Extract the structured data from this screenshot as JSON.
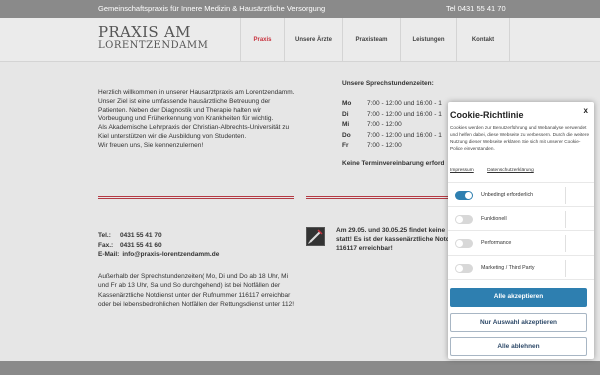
{
  "topbar": {
    "tagline": "Gemeinschaftspraxis für Innere Medizin & Hausärztliche Versorgung",
    "phone": "Tel 0431 55 41 70"
  },
  "logo": {
    "line1": "PRAXIS AM",
    "line2": "LORENTZENDAMM"
  },
  "nav": [
    {
      "label": "Praxis",
      "active": true
    },
    {
      "label": "Unsere Ärzte",
      "active": false
    },
    {
      "label": "Praxisteam",
      "active": false
    },
    {
      "label": "Leistungen",
      "active": false
    },
    {
      "label": "Kontakt",
      "active": false
    }
  ],
  "intro": {
    "p1": "Herzlich willkommen in unserer Hausarztpraxis am Lorentzendamm. Unser Ziel ist eine umfassende hausärztliche Betreuung der Patienten. Neben der Diagnostik und Therapie halten wir Vorbeugung und Früherkennung von Krankheiten für wichtig.",
    "p2": "Als Akademische Lehrpraxis der Christian-Albrechts-Universität zu Kiel unterstützen wir die Ausbildung von Studenten.",
    "p3": "Wir freuen uns, Sie kennenzulernen!"
  },
  "hours": {
    "title": "Unsere Sprechstundenzeiten:",
    "rows": [
      {
        "day": "Mo",
        "time": "7:00 - 12:00 und 16:00 - 1"
      },
      {
        "day": "Di",
        "time": "7:00 - 12:00 und 16:00 - 1"
      },
      {
        "day": "Mi",
        "time": "7:00 - 12:00"
      },
      {
        "day": "Do",
        "time": "7:00 - 12:00 und 16:00 - 1"
      },
      {
        "day": "Fr",
        "time": "7:00 - 12:00"
      }
    ],
    "note": "Keine Terminvereinbarung erforde"
  },
  "contact": {
    "tel_label": "Tel.:",
    "tel": "0431  55 41 70",
    "fax_label": "Fax.:",
    "fax": "0431 55 41 60",
    "email_label": "E-Mail:",
    "email": "info@praxis-lorentzendamm.de",
    "info": "Außerhalb der Sprechstundenzeiten( Mo, Di und Do  ab 18 Uhr, Mi und Fr ab 13 Uhr, Sa und So durchgehend) ist bei Notfällen der Kassenärztliche Notdienst unter der Rufnummer 116117 erreichbar oder bei lebensbedrohlichen Notfällen der Rettungsdienst unter 112!"
  },
  "notice": {
    "text": "Am 29.05. und 30.05.25 findet keine statt! Es ist der kassenärztliche Notd 116117 erreichbar!"
  },
  "cookie": {
    "close": "x",
    "title": "Cookie-Richtlinie",
    "description": "Cookies werden zur Benutzerführung und Webanalyse verwendet und helfen dabei, diese Webseite zu verbessern. Durch die weitere Nutzung dieser Webseite erklären Sie sich mit unserer Cookie-Police einverstanden.",
    "link_impressum": "Impressum",
    "link_datenschutz": "Datenschutzerklärung",
    "toggles": [
      {
        "label": "Unbedingt erforderlich",
        "on": true
      },
      {
        "label": "Funktionell",
        "on": false
      },
      {
        "label": "Performance",
        "on": false
      },
      {
        "label": "Marketing / Third Party",
        "on": false
      }
    ],
    "btn_accept_all": "Alle akzeptieren",
    "btn_accept_selection": "Nur Auswahl akzeptieren",
    "btn_reject_all": "Alle ablehnen",
    "colors": {
      "primary": "#2e7fb0",
      "accent": "#c8333f"
    }
  }
}
